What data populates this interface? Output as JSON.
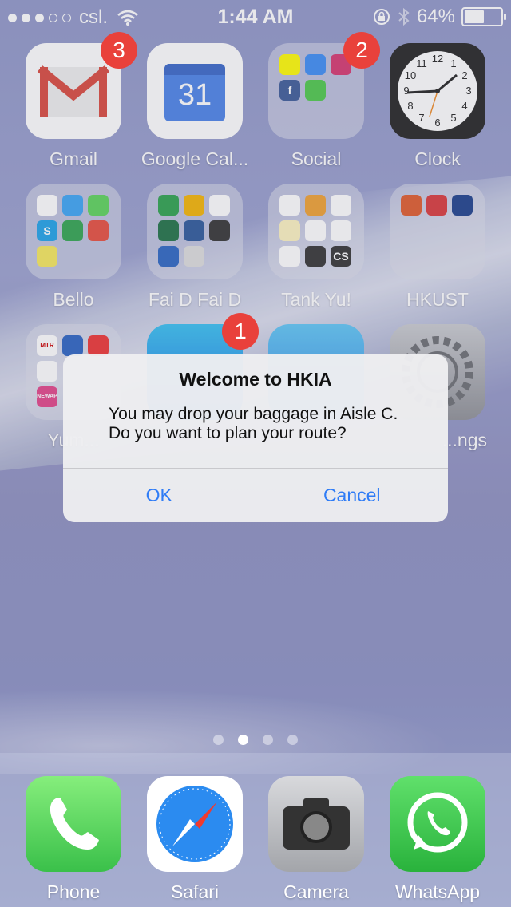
{
  "status_bar": {
    "carrier": "csl.",
    "time": "1:44 AM",
    "battery_percent": "64%",
    "battery_level": 0.64
  },
  "apps": [
    {
      "label": "Gmail",
      "badge": "3"
    },
    {
      "label": "Google Cal...",
      "calendar_day": "31"
    },
    {
      "label": "Social",
      "badge": "2"
    },
    {
      "label": "Clock",
      "numbers": [
        "12",
        "1",
        "2",
        "3",
        "4",
        "5",
        "6",
        "7",
        "8",
        "9",
        "10",
        "11"
      ]
    },
    {
      "label": "Bello"
    },
    {
      "label": "Fai D Fai D"
    },
    {
      "label": "Tank Yu!",
      "cs_text": "CS"
    },
    {
      "label": "HKUST"
    },
    {
      "label": "Yum...",
      "mtr_text": "MTR",
      "newap_text": "NEWAP"
    },
    {
      "label": "",
      "badge": "1"
    },
    {
      "label": ""
    },
    {
      "label": "...ngs"
    }
  ],
  "dialog": {
    "title": "Welcome to HKIA",
    "message_line1": "You may drop your baggage in Aisle C.",
    "message_line2": "Do you want to plan your route?",
    "ok_label": "OK",
    "cancel_label": "Cancel"
  },
  "dock": [
    {
      "label": "Phone"
    },
    {
      "label": "Safari"
    },
    {
      "label": "Camera"
    },
    {
      "label": "WhatsApp"
    }
  ]
}
